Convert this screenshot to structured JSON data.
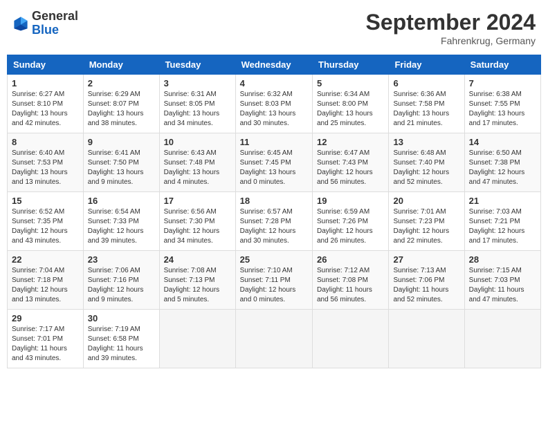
{
  "header": {
    "logo_general": "General",
    "logo_blue": "Blue",
    "month_year": "September 2024",
    "location": "Fahrenkrug, Germany"
  },
  "days_of_week": [
    "Sunday",
    "Monday",
    "Tuesday",
    "Wednesday",
    "Thursday",
    "Friday",
    "Saturday"
  ],
  "weeks": [
    [
      {
        "day": "1",
        "info": "Sunrise: 6:27 AM\nSunset: 8:10 PM\nDaylight: 13 hours\nand 42 minutes."
      },
      {
        "day": "2",
        "info": "Sunrise: 6:29 AM\nSunset: 8:07 PM\nDaylight: 13 hours\nand 38 minutes."
      },
      {
        "day": "3",
        "info": "Sunrise: 6:31 AM\nSunset: 8:05 PM\nDaylight: 13 hours\nand 34 minutes."
      },
      {
        "day": "4",
        "info": "Sunrise: 6:32 AM\nSunset: 8:03 PM\nDaylight: 13 hours\nand 30 minutes."
      },
      {
        "day": "5",
        "info": "Sunrise: 6:34 AM\nSunset: 8:00 PM\nDaylight: 13 hours\nand 25 minutes."
      },
      {
        "day": "6",
        "info": "Sunrise: 6:36 AM\nSunset: 7:58 PM\nDaylight: 13 hours\nand 21 minutes."
      },
      {
        "day": "7",
        "info": "Sunrise: 6:38 AM\nSunset: 7:55 PM\nDaylight: 13 hours\nand 17 minutes."
      }
    ],
    [
      {
        "day": "8",
        "info": "Sunrise: 6:40 AM\nSunset: 7:53 PM\nDaylight: 13 hours\nand 13 minutes."
      },
      {
        "day": "9",
        "info": "Sunrise: 6:41 AM\nSunset: 7:50 PM\nDaylight: 13 hours\nand 9 minutes."
      },
      {
        "day": "10",
        "info": "Sunrise: 6:43 AM\nSunset: 7:48 PM\nDaylight: 13 hours\nand 4 minutes."
      },
      {
        "day": "11",
        "info": "Sunrise: 6:45 AM\nSunset: 7:45 PM\nDaylight: 13 hours\nand 0 minutes."
      },
      {
        "day": "12",
        "info": "Sunrise: 6:47 AM\nSunset: 7:43 PM\nDaylight: 12 hours\nand 56 minutes."
      },
      {
        "day": "13",
        "info": "Sunrise: 6:48 AM\nSunset: 7:40 PM\nDaylight: 12 hours\nand 52 minutes."
      },
      {
        "day": "14",
        "info": "Sunrise: 6:50 AM\nSunset: 7:38 PM\nDaylight: 12 hours\nand 47 minutes."
      }
    ],
    [
      {
        "day": "15",
        "info": "Sunrise: 6:52 AM\nSunset: 7:35 PM\nDaylight: 12 hours\nand 43 minutes."
      },
      {
        "day": "16",
        "info": "Sunrise: 6:54 AM\nSunset: 7:33 PM\nDaylight: 12 hours\nand 39 minutes."
      },
      {
        "day": "17",
        "info": "Sunrise: 6:56 AM\nSunset: 7:30 PM\nDaylight: 12 hours\nand 34 minutes."
      },
      {
        "day": "18",
        "info": "Sunrise: 6:57 AM\nSunset: 7:28 PM\nDaylight: 12 hours\nand 30 minutes."
      },
      {
        "day": "19",
        "info": "Sunrise: 6:59 AM\nSunset: 7:26 PM\nDaylight: 12 hours\nand 26 minutes."
      },
      {
        "day": "20",
        "info": "Sunrise: 7:01 AM\nSunset: 7:23 PM\nDaylight: 12 hours\nand 22 minutes."
      },
      {
        "day": "21",
        "info": "Sunrise: 7:03 AM\nSunset: 7:21 PM\nDaylight: 12 hours\nand 17 minutes."
      }
    ],
    [
      {
        "day": "22",
        "info": "Sunrise: 7:04 AM\nSunset: 7:18 PM\nDaylight: 12 hours\nand 13 minutes."
      },
      {
        "day": "23",
        "info": "Sunrise: 7:06 AM\nSunset: 7:16 PM\nDaylight: 12 hours\nand 9 minutes."
      },
      {
        "day": "24",
        "info": "Sunrise: 7:08 AM\nSunset: 7:13 PM\nDaylight: 12 hours\nand 5 minutes."
      },
      {
        "day": "25",
        "info": "Sunrise: 7:10 AM\nSunset: 7:11 PM\nDaylight: 12 hours\nand 0 minutes."
      },
      {
        "day": "26",
        "info": "Sunrise: 7:12 AM\nSunset: 7:08 PM\nDaylight: 11 hours\nand 56 minutes."
      },
      {
        "day": "27",
        "info": "Sunrise: 7:13 AM\nSunset: 7:06 PM\nDaylight: 11 hours\nand 52 minutes."
      },
      {
        "day": "28",
        "info": "Sunrise: 7:15 AM\nSunset: 7:03 PM\nDaylight: 11 hours\nand 47 minutes."
      }
    ],
    [
      {
        "day": "29",
        "info": "Sunrise: 7:17 AM\nSunset: 7:01 PM\nDaylight: 11 hours\nand 43 minutes."
      },
      {
        "day": "30",
        "info": "Sunrise: 7:19 AM\nSunset: 6:58 PM\nDaylight: 11 hours\nand 39 minutes."
      },
      {
        "day": "",
        "info": ""
      },
      {
        "day": "",
        "info": ""
      },
      {
        "day": "",
        "info": ""
      },
      {
        "day": "",
        "info": ""
      },
      {
        "day": "",
        "info": ""
      }
    ]
  ]
}
